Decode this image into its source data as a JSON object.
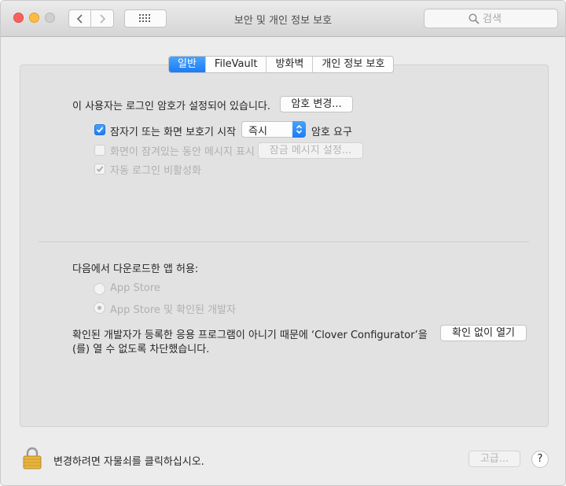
{
  "window": {
    "title": "보안 및 개인 정보 보호",
    "search_placeholder": "검색"
  },
  "tabs": [
    {
      "label": "일반",
      "active": true
    },
    {
      "label": "FileVault",
      "active": false
    },
    {
      "label": "방화벽",
      "active": false
    },
    {
      "label": "개인 정보 보호",
      "active": false
    }
  ],
  "general": {
    "password_set_text": "이 사용자는 로그인 암호가 설정되어 있습니다.",
    "change_password_button": "암호 변경...",
    "require_password": {
      "checked": true,
      "label": "잠자기 또는 화면 보호기 시작",
      "delay_value": "즉시",
      "suffix": "암호 요구"
    },
    "show_message": {
      "checked": false,
      "enabled": false,
      "label": "화면이 잠겨있는 동안 메시지 표시",
      "button": "잠금 메시지 설정..."
    },
    "disable_auto_login": {
      "checked": true,
      "enabled": false,
      "label": "자동 로그인 비활성화"
    }
  },
  "downloads": {
    "heading": "다음에서 다운로드한 앱 허용:",
    "options": [
      {
        "label": "App Store",
        "selected": false
      },
      {
        "label": "App Store 및 확인된 개발자",
        "selected": true
      }
    ],
    "blocked_line1": "확인된 개발자가 등록한 응용 프로그램이 아니기 때문에 ‘Clover Configurator’을",
    "blocked_line2": "(를) 열 수 없도록 차단했습니다.",
    "open_anyway_button": "확인 없이 열기"
  },
  "footer": {
    "lock_text": "변경하려면 자물쇠를 클릭하십시오.",
    "advanced_button": "고급...",
    "help_label": "?"
  },
  "colors": {
    "accent": "#1b7cf5",
    "window_bg": "#ececec",
    "panel_bg": "#e2e2e2",
    "disabled_text": "#b0b0b0"
  }
}
